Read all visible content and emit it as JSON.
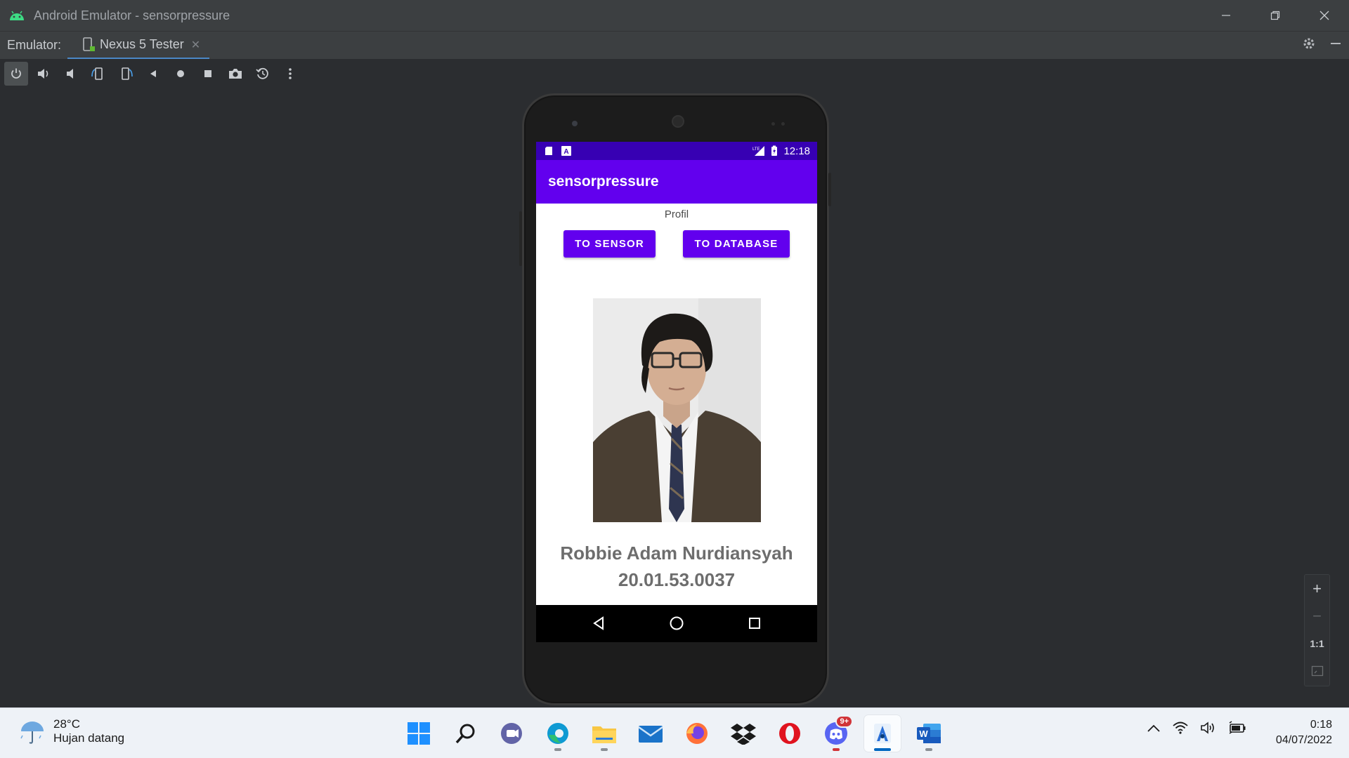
{
  "window": {
    "title": "Android Emulator - sensorpressure",
    "controls": [
      "minimize",
      "restore",
      "close"
    ]
  },
  "tabbar": {
    "label": "Emulator:",
    "tab_label": "Nexus 5 Tester"
  },
  "toolbar": {
    "tools": [
      "power",
      "volume-up",
      "volume-down",
      "rotate-left",
      "rotate-right",
      "back",
      "home",
      "overview",
      "screenshot",
      "snapshot",
      "more"
    ]
  },
  "device_screen": {
    "status_time": "12:18",
    "network_label": "LTE",
    "app_title": "sensorpressure",
    "profile_label": "Profil",
    "btn_sensor": "TO SENSOR",
    "btn_database": "TO DATABASE",
    "name": "Robbie Adam Nurdiansyah",
    "student_id": "20.01.53.0037"
  },
  "zoom": {
    "zoom_in": "+",
    "zoom_out": "−",
    "actual_size": "1:1"
  },
  "taskbar": {
    "weather_temp": "28°C",
    "weather_cond": "Hujan datang",
    "discord_badge": "9+",
    "clock_time": "0:18",
    "clock_date": "04/07/2022"
  },
  "colors": {
    "primary": "#6200ee",
    "primary_dark": "#3700b3",
    "ide_bg": "#2b2d30",
    "ide_bar": "#3c3f41"
  }
}
